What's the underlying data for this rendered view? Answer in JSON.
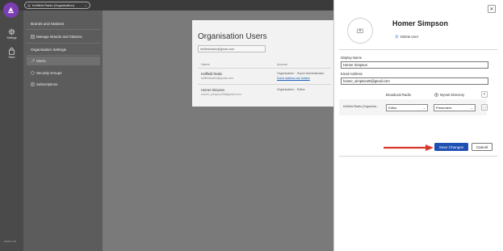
{
  "topbar": {
    "org_selector_label": "Kellfield Radio (Organisation)",
    "chevron_icon": "chevron-down-icon"
  },
  "rail": {
    "items": [
      {
        "label": "Settings",
        "icon": "gear-icon"
      },
      {
        "label": "Store",
        "icon": "store-icon"
      }
    ],
    "version": "Version 2.0"
  },
  "nav": {
    "items": [
      {
        "label": "Brands and Stations",
        "type": "heading"
      },
      {
        "label": "Manage Brands and Stations",
        "icon": "list-icon"
      },
      {
        "label": "Organisation Settings",
        "type": "heading"
      },
      {
        "label": "Users",
        "icon": "users-icon",
        "active": true
      },
      {
        "label": "Security Groups",
        "icon": "shield-icon"
      },
      {
        "label": "Subscriptions",
        "icon": "receipt-icon"
      }
    ]
  },
  "main": {
    "title": "Organisation Users",
    "search_value": "kellfieldradio@gmail.com",
    "columns": [
      "Name",
      "Access"
    ],
    "rows": [
      {
        "name": "Kellfield Radio",
        "email": "kellfieldradio@gmail.com",
        "access": "Organisation · Super Administrator",
        "link": "Some stations are hidden"
      },
      {
        "name": "Homer Simpson",
        "email": "homer_simpson26@gmail.com",
        "access": "Organisation · Editor",
        "link": ""
      }
    ]
  },
  "panel": {
    "user_name": "Homer Simpson",
    "delete_label": "Delete User",
    "display_name_label": "Display Name",
    "display_name_value": "Homer Simpson",
    "email_label": "Email Address",
    "email_value": "homer_simpson26@gmail.com",
    "assignment": {
      "head_radio": "Broadcast Radio",
      "head_mynoit": "Mynoit Directory",
      "row_label": "Kellfield Radio (Organisat...",
      "role_value": "Editor",
      "mynoit_value": "Presenters"
    },
    "save_label": "Save Changes",
    "cancel_label": "Cancel",
    "close_glyph": "✕",
    "plus_glyph": "+",
    "more_glyph": "···"
  },
  "colors": {
    "accent": "#1f4fb3",
    "logo": "#7b3fb3",
    "arrow": "#d9382c"
  }
}
